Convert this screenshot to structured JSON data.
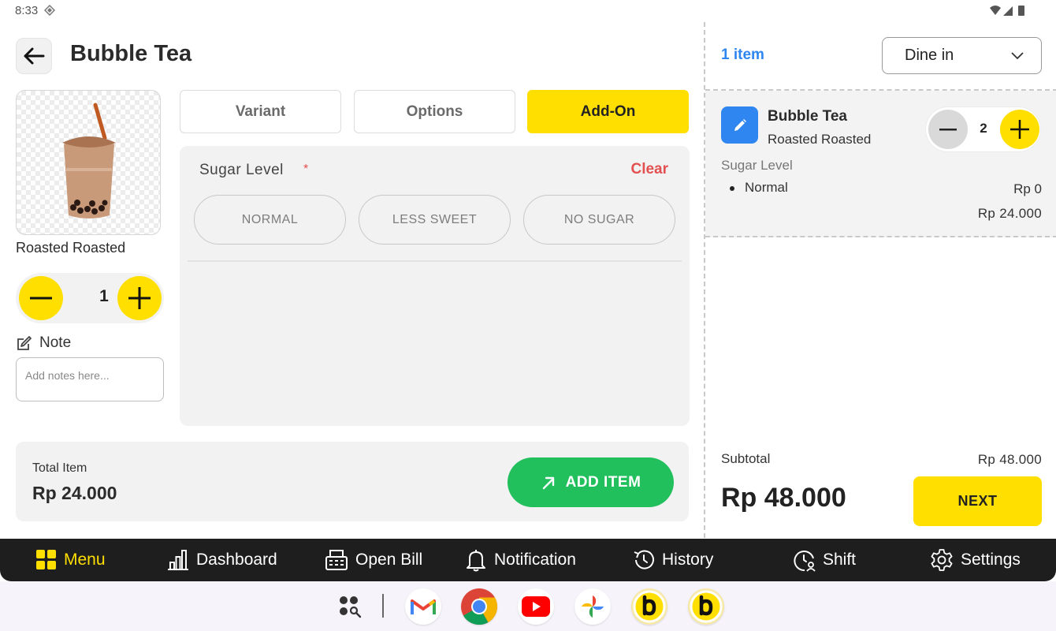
{
  "status_bar": {
    "time": "8:33"
  },
  "header": {
    "title": "Bubble Tea"
  },
  "product": {
    "name": "Roasted Roasted",
    "quantity": "1"
  },
  "note": {
    "label": "Note",
    "placeholder": "Add notes here..."
  },
  "tabs": [
    {
      "label": "Variant",
      "active": false
    },
    {
      "label": "Options",
      "active": false
    },
    {
      "label": "Add-On",
      "active": true
    }
  ],
  "option_group": {
    "title": "Sugar Level",
    "required_mark": "*",
    "clear_label": "Clear",
    "choices": [
      "NORMAL",
      "LESS SWEET",
      "NO SUGAR"
    ]
  },
  "total": {
    "label": "Total Item",
    "value": "Rp 24.000",
    "add_button": "ADD ITEM"
  },
  "cart": {
    "count_label": "1 item",
    "order_type": "Dine in",
    "item": {
      "name": "Bubble Tea",
      "variant": "Roasted Roasted",
      "quantity": "2",
      "group": "Sugar Level",
      "option": "Normal",
      "option_price": "Rp 0",
      "price": "Rp 24.000"
    },
    "subtotal_label": "Subtotal",
    "subtotal_value": "Rp 48.000",
    "grand_total": "Rp 48.000",
    "next_label": "NEXT"
  },
  "nav": {
    "items": [
      {
        "label": "Menu",
        "icon": "grid-icon",
        "active": true
      },
      {
        "label": "Dashboard",
        "icon": "bar-chart-icon",
        "active": false
      },
      {
        "label": "Open Bill",
        "icon": "cash-register-icon",
        "active": false
      },
      {
        "label": "Notification",
        "icon": "bell-icon",
        "active": false
      },
      {
        "label": "History",
        "icon": "history-icon",
        "active": false
      },
      {
        "label": "Shift",
        "icon": "clock-user-icon",
        "active": false
      },
      {
        "label": "Settings",
        "icon": "gear-icon",
        "active": false
      }
    ]
  },
  "dock_apps": [
    "app-drawer-icon",
    "gmail-icon",
    "chrome-icon",
    "youtube-icon",
    "photos-icon",
    "b-app-icon",
    "b-app-icon"
  ],
  "colors": {
    "accent": "#ffdf00",
    "success": "#22bf5d",
    "link": "#2f86f0",
    "danger": "#e25050",
    "nav_bg": "#1e1e1e"
  }
}
